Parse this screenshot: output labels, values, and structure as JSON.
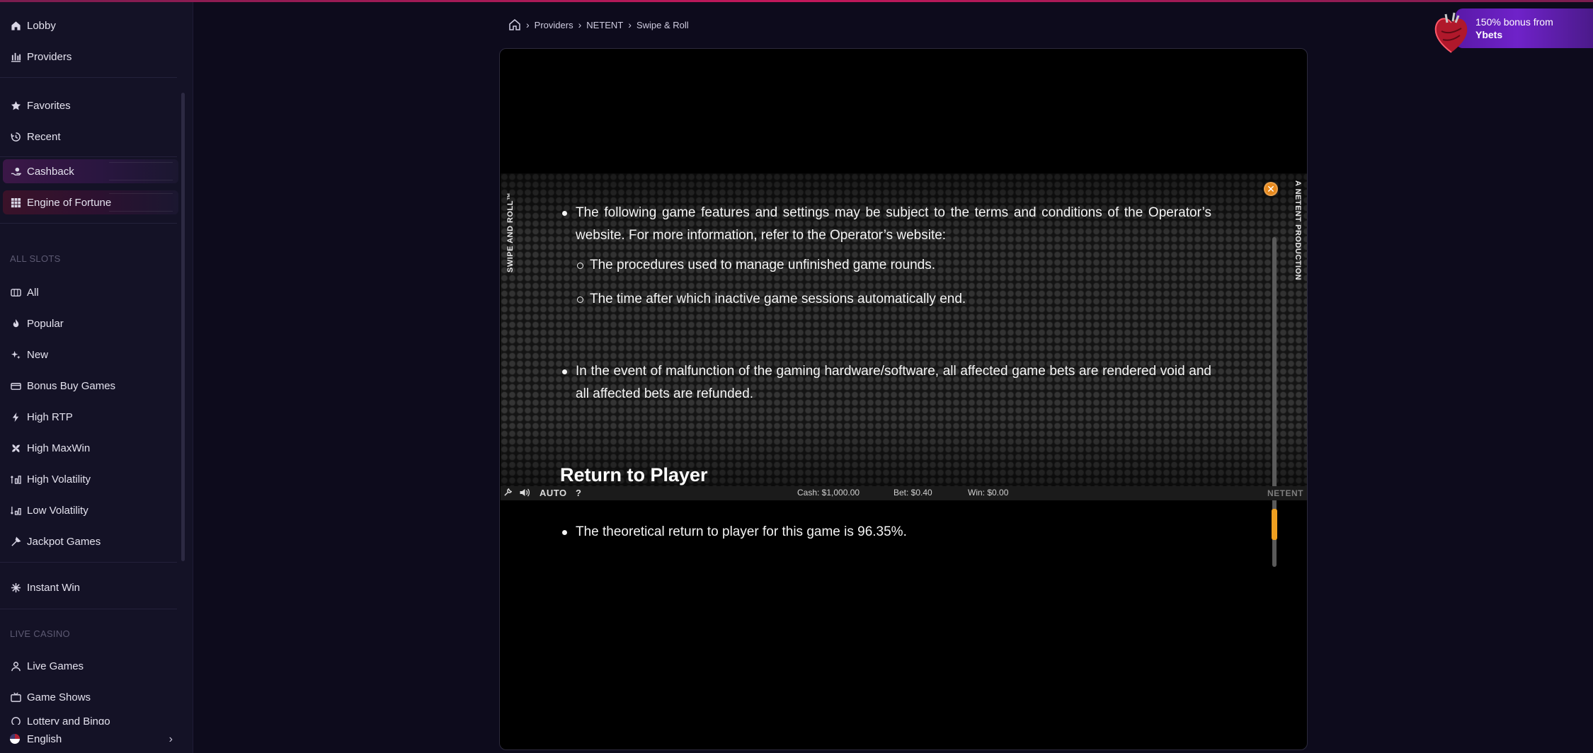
{
  "sidebar": {
    "top_items": [
      {
        "label": "Lobby",
        "icon": "home-icon"
      },
      {
        "label": "Providers",
        "icon": "providers-icon"
      }
    ],
    "user_items": [
      {
        "label": "Favorites",
        "icon": "star-icon"
      },
      {
        "label": "Recent",
        "icon": "history-icon"
      }
    ],
    "promo_items": [
      {
        "label": "Cashback",
        "icon": "cashback-icon"
      },
      {
        "label": "Engine of Fortune",
        "icon": "grid-icon"
      }
    ],
    "slots_title": "ALL SLOTS",
    "slots_items": [
      {
        "label": "All",
        "icon": "slots-icon"
      },
      {
        "label": "Popular",
        "icon": "fire-icon"
      },
      {
        "label": "New",
        "icon": "sparkle-icon"
      },
      {
        "label": "Bonus Buy Games",
        "icon": "bonus-buy-icon"
      },
      {
        "label": "High RTP",
        "icon": "bolt-icon"
      },
      {
        "label": "High MaxWin",
        "icon": "maxwin-icon"
      },
      {
        "label": "High Volatility",
        "icon": "volatility-high-icon"
      },
      {
        "label": "Low Volatility",
        "icon": "volatility-low-icon"
      },
      {
        "label": "Jackpot Games",
        "icon": "jackpot-icon"
      }
    ],
    "instant_item": {
      "label": "Instant Win",
      "icon": "instant-win-icon"
    },
    "live_title": "LIVE CASINO",
    "live_items": [
      {
        "label": "Live Games",
        "icon": "live-games-icon"
      },
      {
        "label": "Game Shows",
        "icon": "game-shows-icon"
      },
      {
        "label": "Lottery and Bingo",
        "icon": "lottery-icon"
      }
    ],
    "language": "English"
  },
  "breadcrumb": {
    "items": [
      "Providers",
      "NETENT",
      "Swipe & Roll"
    ]
  },
  "bonus_banner": {
    "line1": "150% bonus from",
    "line2": "Ybets"
  },
  "game": {
    "vertical_left": "SWIPE AND ROLL™",
    "vertical_right": "A NETENT PRODUCTION",
    "rules": {
      "bullet1": "The following game features and settings may be subject to the terms and conditions of the Operator’s website. For more information, refer to the Operator’s website:",
      "sub1": "The procedures used to manage unfinished game rounds.",
      "sub2": "The time after which inactive game sessions automatically end.",
      "bullet2": "In the event of malfunction of the gaming hardware/software, all affected game bets are rendered void and all affected bets are refunded.",
      "heading": "Return to Player",
      "bullet3": "The theoretical return to player for this game is 96.35%."
    },
    "bar": {
      "auto": "AUTO",
      "help": "?",
      "cash": "Cash: $1,000.00",
      "bet": "Bet: $0.40",
      "win": "Win: $0.00",
      "brand": "NETENT"
    }
  }
}
